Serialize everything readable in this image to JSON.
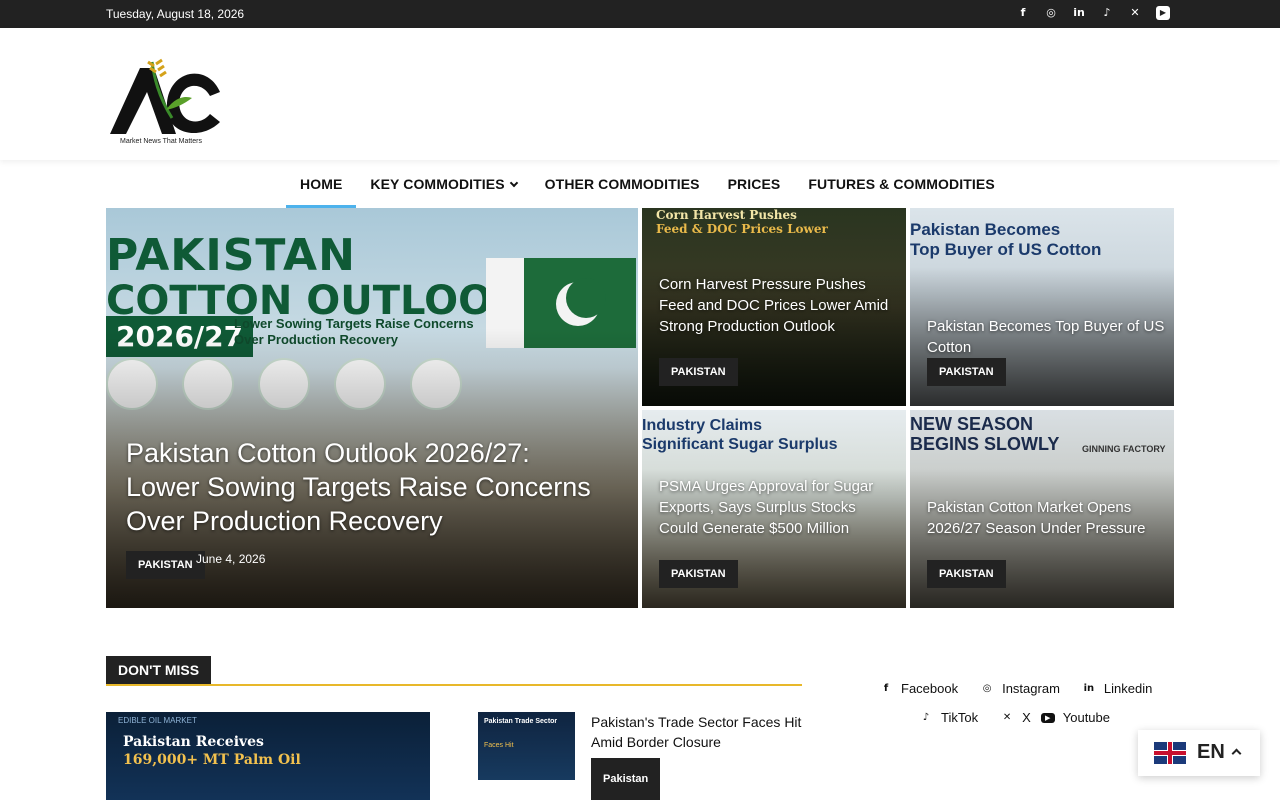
{
  "topbar": {
    "date": "Tuesday, August 18, 2026",
    "socials": [
      "facebook-icon",
      "instagram-icon",
      "linkedin-icon",
      "tiktok-icon",
      "x-icon",
      "youtube-icon"
    ]
  },
  "logo": {
    "letters": "AC",
    "tagline": "Market News That Matters"
  },
  "nav": {
    "items": [
      {
        "label": "HOME",
        "active": true
      },
      {
        "label": "KEY COMMODITIES",
        "has_dropdown": true
      },
      {
        "label": "OTHER COMMODITIES"
      },
      {
        "label": "PRICES"
      },
      {
        "label": "FUTURES & COMMODITIES"
      }
    ]
  },
  "hero": {
    "main": {
      "image_text": {
        "line1": "PAKISTAN",
        "line2": "COTTON OUTLOOK",
        "year": "2026/27",
        "subtitle": "Lower Sowing Targets Raise Concerns Over Production Recovery"
      },
      "title": "Pakistan Cotton Outlook 2026/27: Lower Sowing Targets Raise Concerns Over Production Recovery",
      "category": "PAKISTAN",
      "date": "June 4, 2026"
    },
    "corn": {
      "image_text": {
        "line1": "Corn Harvest Pushes",
        "line2": "Feed & DOC Prices Lower"
      },
      "title": "Corn Harvest Pressure Pushes Feed and DOC Prices Lower Amid Strong Production Outlook",
      "category": "PAKISTAN"
    },
    "us_cotton": {
      "image_text": {
        "line1": "Pakistan Becomes",
        "line2": "Top Buyer of US Cotton"
      },
      "title": "Pakistan Becomes Top Buyer of US Cotton",
      "category": "PAKISTAN"
    },
    "sugar": {
      "image_text": {
        "line1": "Industry Claims",
        "line2": "Significant Sugar Surplus"
      },
      "title": "PSMA Urges Approval for Sugar Exports, Says Surplus Stocks Could Generate $500 Million",
      "category": "PAKISTAN"
    },
    "ginning": {
      "image_text": {
        "line1": "NEW SEASON",
        "line2": "BEGINS SLOWLY",
        "sign": "GINNING FACTORY"
      },
      "title": "Pakistan Cotton Market Opens 2026/27 Season Under Pressure",
      "category": "PAKISTAN"
    }
  },
  "dont_miss": {
    "heading": "DON'T MISS",
    "feature_thumb": {
      "kicker": "EDIBLE OIL MARKET",
      "line1": "Pakistan Receives",
      "line2": "169,000+ MT Palm Oil"
    },
    "side_thumb": {
      "line1": "Pakistan Trade Sector",
      "line2": "Faces Hit"
    },
    "side_title": "Pakistan's Trade Sector Faces Hit Amid Border Closure",
    "side_category": "Pakistan"
  },
  "social_links": [
    {
      "icon": "facebook-icon",
      "label": "Facebook"
    },
    {
      "icon": "instagram-icon",
      "label": "Instagram"
    },
    {
      "icon": "linkedin-icon",
      "label": "Linkedin"
    },
    {
      "icon": "tiktok-icon",
      "label": "TikTok"
    },
    {
      "icon": "x-icon",
      "label": "X"
    },
    {
      "icon": "youtube-icon",
      "label": "Youtube"
    }
  ],
  "language": {
    "code": "EN"
  },
  "colors": {
    "accent": "#4db2ec",
    "dont_miss_line": "#e8b82a",
    "dark": "#222222",
    "flag_green": "#1d6b3a"
  }
}
